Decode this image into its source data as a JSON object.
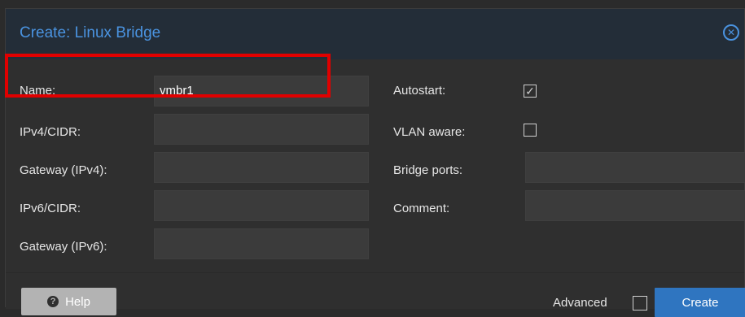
{
  "dialog": {
    "title": "Create: Linux Bridge",
    "close_icon": "close-circle-icon"
  },
  "form": {
    "left": [
      {
        "label": "Name:",
        "value": "vmbr1"
      },
      {
        "label": "IPv4/CIDR:",
        "value": ""
      },
      {
        "label": "Gateway (IPv4):",
        "value": ""
      },
      {
        "label": "IPv6/CIDR:",
        "value": ""
      },
      {
        "label": "Gateway (IPv6):",
        "value": ""
      }
    ],
    "right": {
      "autostart": {
        "label": "Autostart:",
        "checked": true
      },
      "vlan_aware": {
        "label": "VLAN aware:",
        "checked": false
      },
      "bridge_ports": {
        "label": "Bridge ports:",
        "value": ""
      },
      "comment": {
        "label": "Comment:",
        "value": ""
      }
    }
  },
  "footer": {
    "help_label": "Help",
    "help_icon": "question-circle-icon",
    "advanced_label": "Advanced",
    "advanced_checked": false,
    "create_label": "Create"
  },
  "colors": {
    "accent": "#4a93e0",
    "primary_button": "#2f75c0",
    "highlight": "#e00000"
  }
}
